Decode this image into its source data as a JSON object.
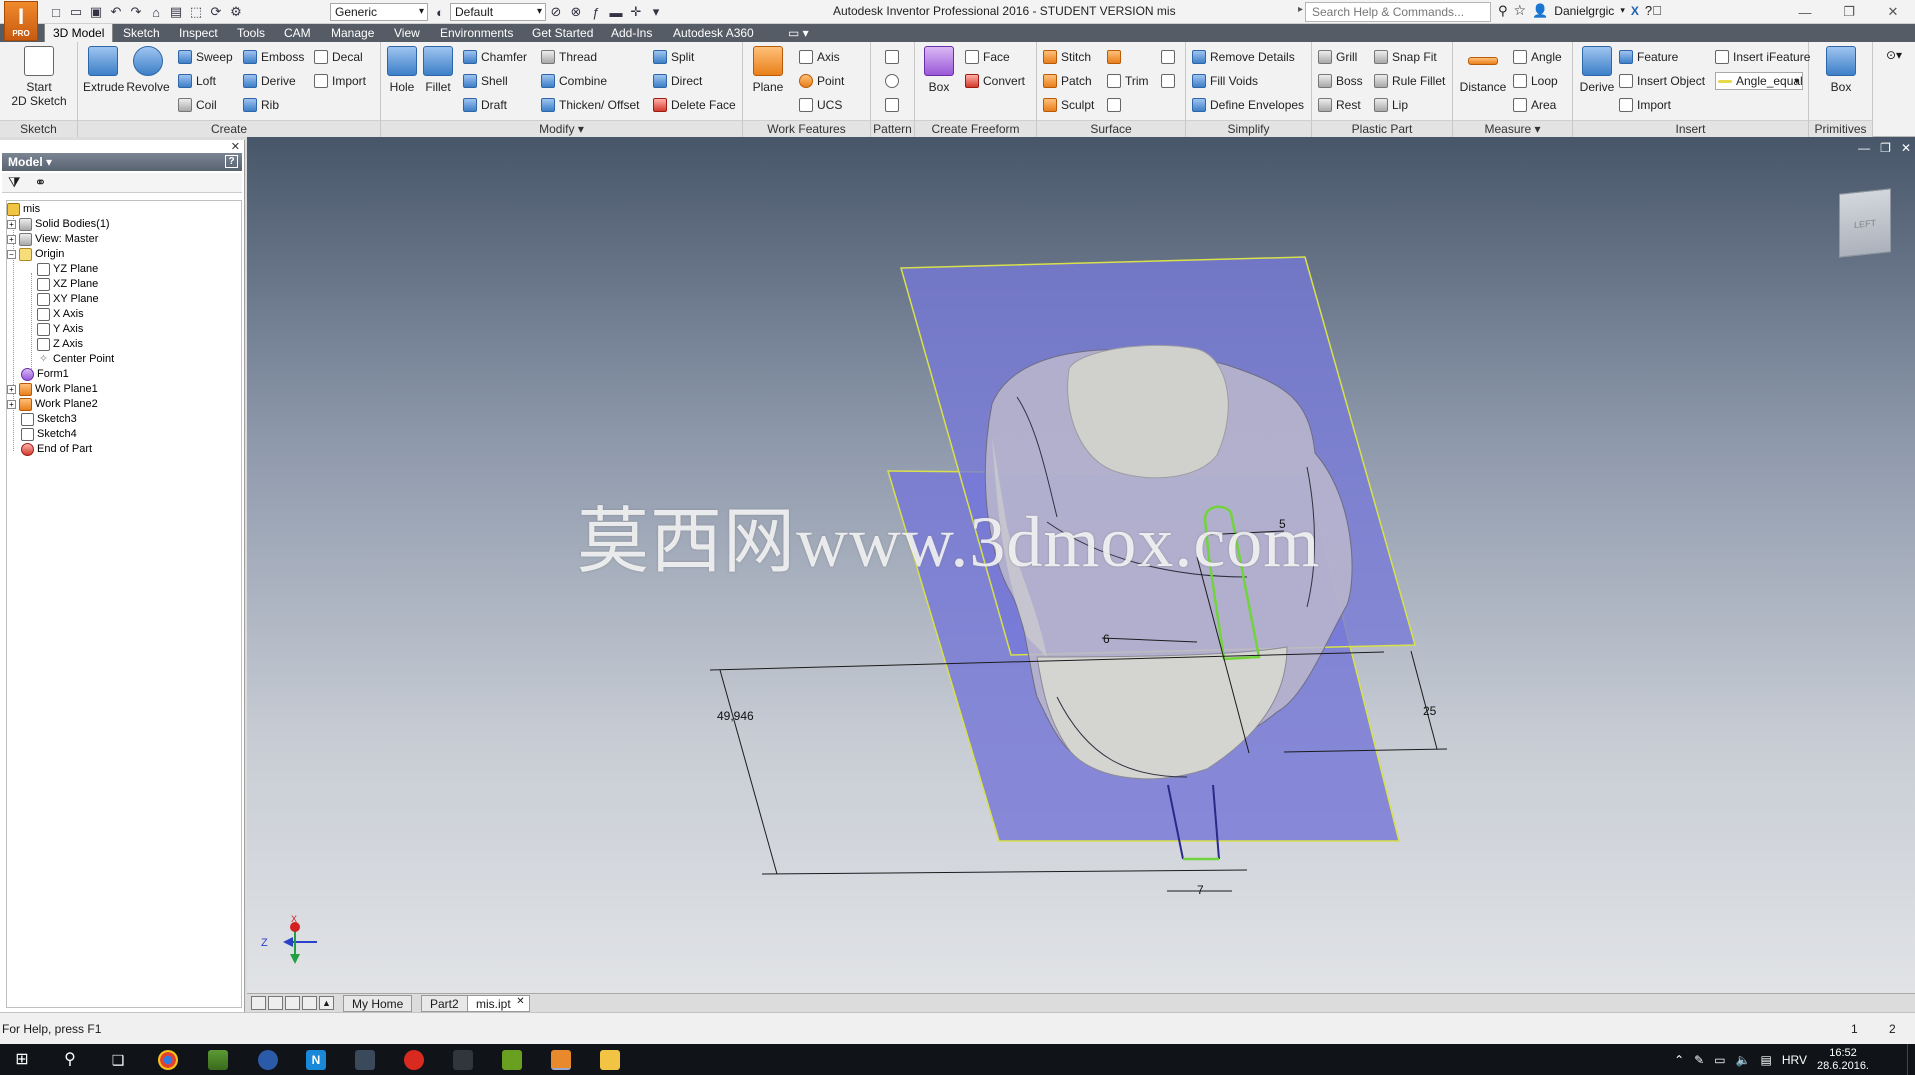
{
  "app": {
    "logo_text": "I",
    "logo_sub": "PRO",
    "window_title": "Autodesk Inventor Professional 2016 - STUDENT VERSION   mis"
  },
  "quick_access": {
    "material_value": "Generic",
    "appearance_value": "Default"
  },
  "search": {
    "placeholder": "Search Help & Commands..."
  },
  "user": {
    "name": "Danielgrgic"
  },
  "ribbon_tabs": [
    "3D Model",
    "Sketch",
    "Inspect",
    "Tools",
    "CAM",
    "Manage",
    "View",
    "Environments",
    "Get Started",
    "Add-Ins",
    "Autodesk A360"
  ],
  "ribbon": {
    "sketch": {
      "title": "Sketch",
      "start_label": "Start\n2D Sketch"
    },
    "create": {
      "title": "Create",
      "extrude": "Extrude",
      "revolve": "Revolve",
      "sweep": "Sweep",
      "loft": "Loft",
      "coil": "Coil",
      "emboss": "Emboss",
      "derive": "Derive",
      "rib": "Rib",
      "decal": "Decal",
      "import": "Import"
    },
    "modify": {
      "title": "Modify ▾",
      "hole": "Hole",
      "fillet": "Fillet",
      "chamfer": "Chamfer",
      "shell": "Shell",
      "draft": "Draft",
      "thread": "Thread",
      "combine": "Combine",
      "thicken": "Thicken/ Offset",
      "split": "Split",
      "direct": "Direct",
      "delete_face": "Delete Face"
    },
    "work_features": {
      "title": "Work Features",
      "plane": "Plane",
      "axis": "Axis",
      "point": "Point",
      "ucs": "UCS"
    },
    "pattern": {
      "title": "Pattern"
    },
    "freeform": {
      "title": "Create Freeform",
      "box": "Box",
      "face": "Face",
      "convert": "Convert"
    },
    "surface": {
      "title": "Surface",
      "stitch": "Stitch",
      "patch": "Patch",
      "sculpt": "Sculpt",
      "trim": "Trim"
    },
    "simplify": {
      "title": "Simplify",
      "remove_details": "Remove Details",
      "fill_voids": "Fill Voids",
      "define_envelopes": "Define Envelopes"
    },
    "plastic": {
      "title": "Plastic Part",
      "grill": "Grill",
      "boss": "Boss",
      "rest": "Rest",
      "snap_fit": "Snap Fit",
      "rule_fillet": "Rule Fillet",
      "lip": "Lip"
    },
    "measure": {
      "title": "Measure ▾",
      "distance": "Distance",
      "angle": "Angle",
      "loop": "Loop",
      "area": "Area"
    },
    "insert": {
      "title": "Insert",
      "derive": "Derive",
      "feature": "Feature",
      "insert_object": "Insert Object",
      "import": "Import",
      "insert_ifeature": "Insert iFeature",
      "param_value": "Angle_equal"
    },
    "primitives": {
      "title": "Primitives",
      "box": "Box"
    }
  },
  "browser": {
    "title": "Model ▾",
    "help": "?",
    "tree": [
      {
        "label": "mis"
      },
      {
        "label": "Solid Bodies(1)"
      },
      {
        "label": "View: Master"
      },
      {
        "label": "Origin"
      },
      {
        "label": "YZ Plane"
      },
      {
        "label": "XZ Plane"
      },
      {
        "label": "XY Plane"
      },
      {
        "label": "X Axis"
      },
      {
        "label": "Y Axis"
      },
      {
        "label": "Z Axis"
      },
      {
        "label": "Center Point"
      },
      {
        "label": "Form1"
      },
      {
        "label": "Work Plane1"
      },
      {
        "label": "Work Plane2"
      },
      {
        "label": "Sketch3"
      },
      {
        "label": "Sketch4"
      },
      {
        "label": "End of Part"
      }
    ]
  },
  "viewport": {
    "viewcube_label": "LEFT",
    "dimensions": {
      "d1": "49,946",
      "d2": "5",
      "d3": "6",
      "d4": "25",
      "d5": "7"
    },
    "triad": {
      "x": "X",
      "z": "Z"
    },
    "watermark": "莫西网www.3dmox.com"
  },
  "doc_tabs": [
    "My Home",
    "Part2",
    "mis.ipt"
  ],
  "status": {
    "help_text": "For Help, press F1",
    "n1": "1",
    "n2": "2"
  },
  "taskbar": {
    "lang": "HRV",
    "time": "16:52",
    "date": "28.6.2016."
  }
}
